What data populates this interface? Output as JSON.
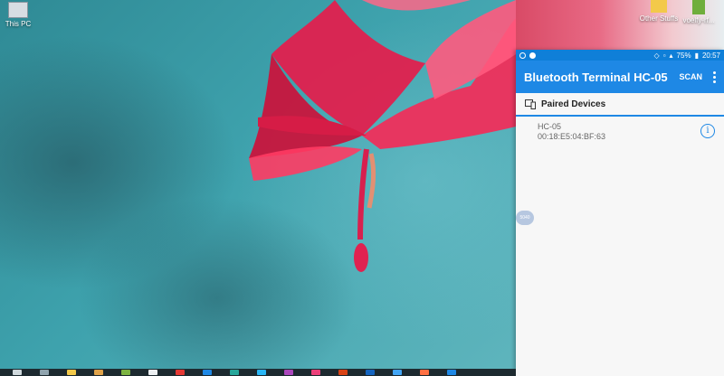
{
  "desktop": {
    "icons": [
      {
        "label": "This PC"
      },
      {
        "label": "Other Stuffs"
      },
      {
        "label": "voelfy-rf..."
      }
    ]
  },
  "phone": {
    "status_bar": {
      "battery": "75%",
      "time": "20:57"
    },
    "app_title": "Bluetooth Terminal HC-05",
    "scan_label": "SCAN",
    "section_title": "Paired Devices",
    "devices": [
      {
        "name": "HC-05",
        "mac": "00:18:E5:04:BF:63"
      }
    ],
    "float_handle_label": "5040"
  },
  "colors": {
    "accent": "#1e88e5",
    "status_bar": "#0f7fd8"
  },
  "taskbar": {
    "icons": [
      "search-icon",
      "task-view-icon",
      "file-explorer-icon",
      "chrome-icon",
      "store-icon",
      "app-icon-1",
      "app-icon-2",
      "app-icon-3",
      "app-icon-4",
      "app-icon-5",
      "app-icon-6",
      "app-icon-7",
      "app-icon-8",
      "app-icon-9",
      "app-icon-10",
      "app-icon-11",
      "app-icon-12"
    ]
  }
}
